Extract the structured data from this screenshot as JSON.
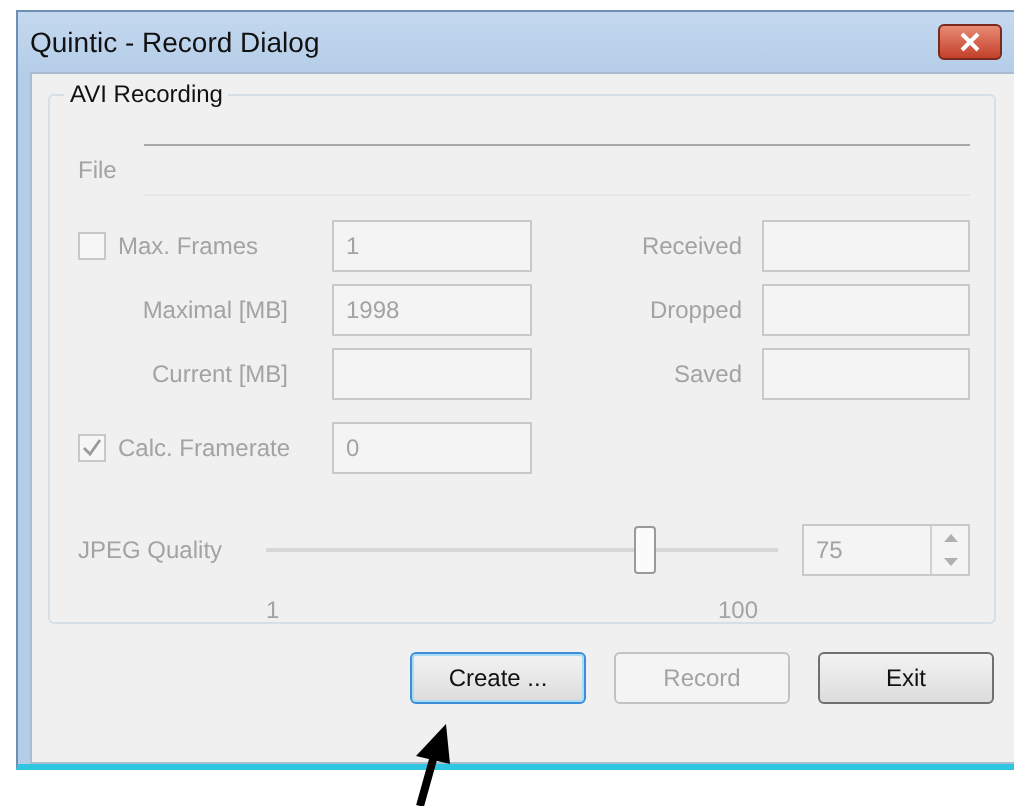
{
  "window": {
    "title": "Quintic - Record Dialog"
  },
  "group": {
    "title": "AVI Recording",
    "file": {
      "label": "File"
    },
    "left_rows": [
      {
        "kind": "checkbox",
        "label": "Max. Frames",
        "checked": false,
        "value": "1"
      },
      {
        "kind": "label",
        "label": "Maximal [MB]",
        "value": "1998"
      },
      {
        "kind": "label",
        "label": "Current [MB]"
      },
      {
        "kind": "checkbox",
        "label": "Calc. Framerate",
        "checked": true,
        "value": "0"
      }
    ],
    "right_rows": [
      {
        "label": "Received"
      },
      {
        "label": "Dropped"
      },
      {
        "label": "Saved"
      }
    ],
    "quality": {
      "label": "JPEG Quality",
      "level": 0.74,
      "value": "75",
      "min_label": "1",
      "max_label": "100"
    }
  },
  "buttons": [
    {
      "label": "Create ...",
      "focused": true,
      "disabled": false
    },
    {
      "label": "Record",
      "focused": false,
      "disabled": true
    },
    {
      "label": "Exit",
      "focused": false,
      "disabled": false
    }
  ]
}
